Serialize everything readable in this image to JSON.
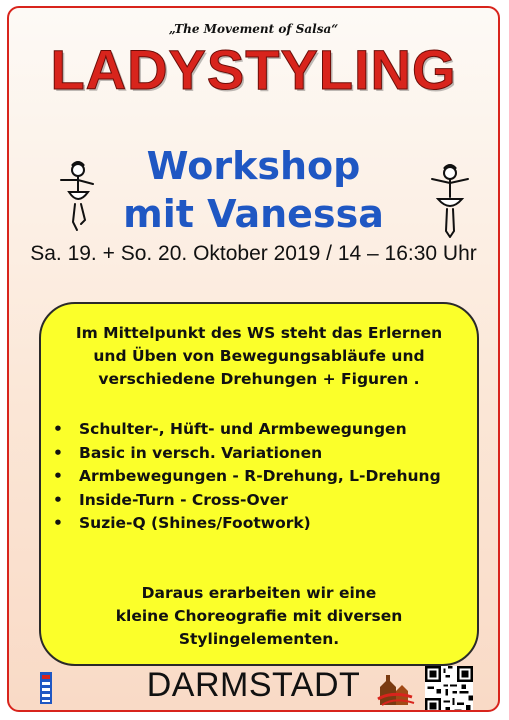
{
  "header": {
    "tagline": "„The Movement of Salsa“",
    "title": "LADYSTYLING"
  },
  "workshop": {
    "line1": "Workshop",
    "line2": "mit Vanessa",
    "date": "Sa. 19. + So. 20. Oktober 2019 / 14 – 16:30 Uhr"
  },
  "info": {
    "intro": [
      "Im Mittelpunkt des WS steht das Erlernen",
      "und Üben von  Bewegungsabläufe und",
      "verschiedene Drehungen + Figuren ."
    ],
    "bullet_symbol": "•",
    "bullets": [
      "Schulter-, Hüft- und Armbewegungen",
      "Basic in versch. Variationen",
      "Armbewegungen - R-Drehung, L-Drehung",
      "Inside-Turn - Cross-Over",
      "Suzie-Q (Shines/Footwork)"
    ],
    "outro": [
      "Daraus erarbeiten wir eine",
      "kleine Choreografie mit diversen",
      "Stylingelementen."
    ]
  },
  "footer": {
    "city": "DARMSTADT"
  },
  "colors": {
    "title_red": "#d8241c",
    "workshop_blue": "#1f57c3",
    "box_yellow": "#fbff2a"
  }
}
